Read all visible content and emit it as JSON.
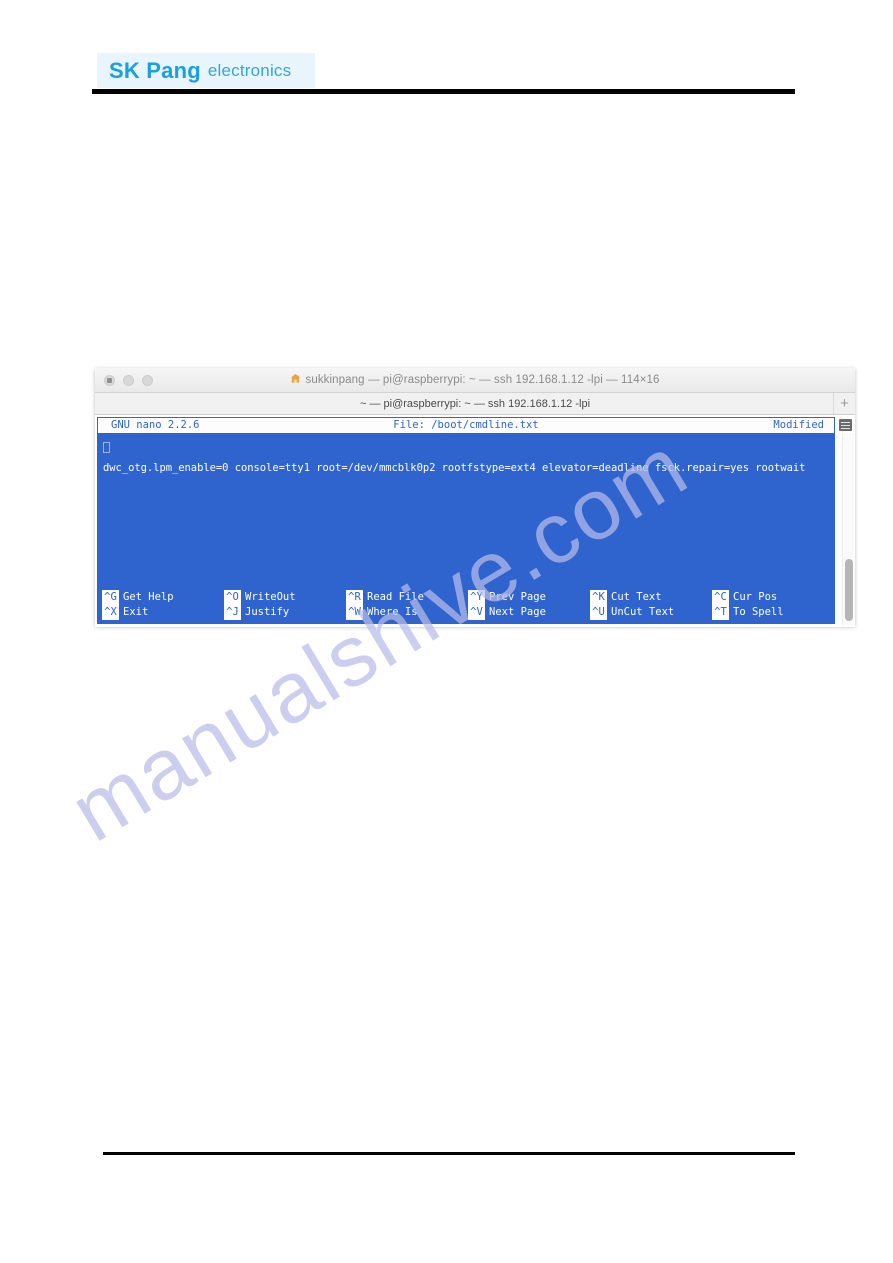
{
  "document": {
    "brand": {
      "name_bold": "SK Pang",
      "name_light": "electronics",
      "logo_color": "#1a9fe0",
      "logo_bg": "#e8f5fd"
    },
    "watermark": "manualshive.com"
  },
  "terminal": {
    "window_title": "sukkinpang — pi@raspberrypi: ~ — ssh 192.168.1.12 -lpi — 114×16",
    "home_icon": "house-icon",
    "tab_label": "~ — pi@raspberrypi: ~ — ssh 192.168.1.12 -lpi",
    "new_tab_label": "+",
    "traffic_lights": [
      "close-button",
      "minimize-button",
      "zoom-button"
    ],
    "background_color": "#2f63ce",
    "text_color": "#ffffff"
  },
  "nano": {
    "header": {
      "version": "GNU nano 2.2.6",
      "file": "File: /boot/cmdline.txt",
      "status": "Modified"
    },
    "content": {
      "cursor_placeholder": "",
      "line1": "dwc_otg.lpm_enable=0 console=tty1 root=/dev/mmcblk0p2 rootfstype=ext4 elevator=deadline fsck.repair=yes rootwait"
    },
    "shortcuts": [
      {
        "key1": "^G",
        "label1": "Get Help",
        "key2": "^X",
        "label2": "Exit"
      },
      {
        "key1": "^O",
        "label1": "WriteOut",
        "key2": "^J",
        "label2": "Justify"
      },
      {
        "key1": "^R",
        "label1": "Read File",
        "key2": "^W",
        "label2": "Where Is"
      },
      {
        "key1": "^Y",
        "label1": "Prev Page",
        "key2": "^V",
        "label2": "Next Page"
      },
      {
        "key1": "^K",
        "label1": "Cut Text",
        "key2": "^U",
        "label2": "UnCut Text"
      },
      {
        "key1": "^C",
        "label1": "Cur Pos",
        "key2": "^T",
        "label2": "To Spell"
      }
    ]
  }
}
